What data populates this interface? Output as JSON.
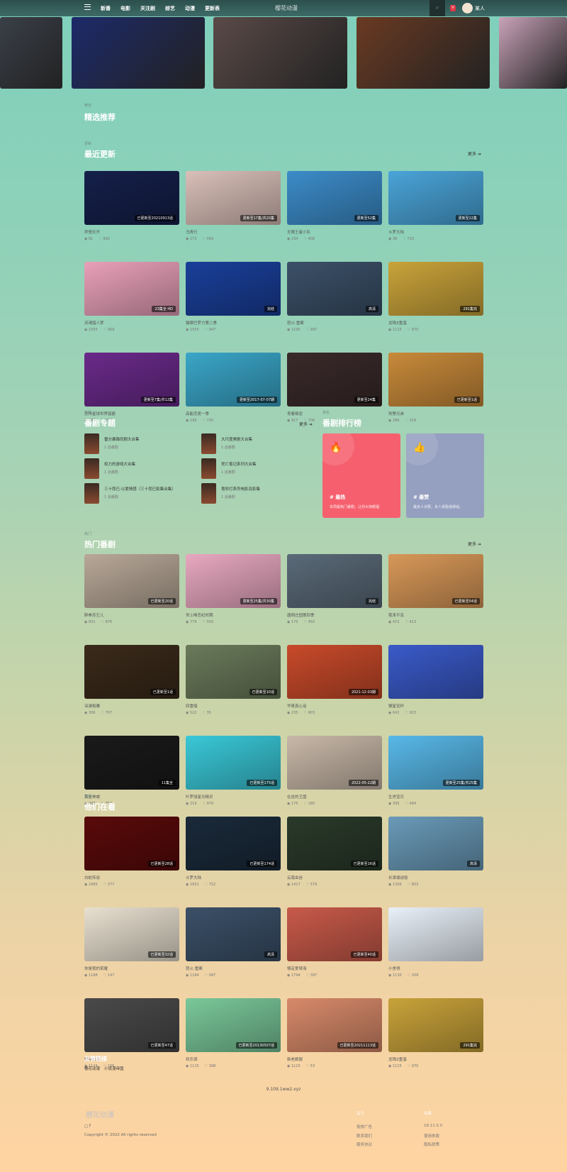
{
  "header": {
    "nav": [
      "新番",
      "电影",
      "关注剧",
      "综艺",
      "动漫",
      "更新表"
    ],
    "logo": "樱花动漫",
    "search_icon": "search-icon",
    "vip": "V",
    "username": "某人"
  },
  "banners": [
    {
      "color": "#3a3f48"
    },
    {
      "color": "#1d2a6a"
    },
    {
      "color": "#5a4a48"
    },
    {
      "color": "#6a3a22"
    },
    {
      "color": "#c9a2b8"
    }
  ],
  "featured": {
    "label": "精选",
    "title": "精选推荐"
  },
  "recent": {
    "label": "更新",
    "title": "最近更新",
    "more": "更多 ➔",
    "items": [
      {
        "name": "异想天开",
        "badge": "已更新至20210913话",
        "views": "81",
        "likes": "992",
        "color": "#15204a"
      },
      {
        "name": "乌青行",
        "badge": "更新至17集/共20集",
        "views": "272",
        "likes": "569",
        "color": "#d9bfb8"
      },
      {
        "name": "无限王者小队",
        "badge": "更新至52集",
        "views": "234",
        "likes": "408",
        "color": "#3c8cc9"
      },
      {
        "name": "斗罗大陆",
        "badge": "更新至22集",
        "views": "38",
        "likes": "729",
        "color": "#4aa4d8"
      },
      {
        "name": "灵魂猎人梦",
        "badge": "23集全 HD",
        "views": "1055",
        "likes": "909",
        "color": "#e8a0b8"
      },
      {
        "name": "猫眼巴罗力第二季",
        "badge": "完结",
        "views": "1055",
        "likes": "947",
        "color": "#1a3f9a"
      },
      {
        "name": "怒火·重案",
        "badge": "高清",
        "views": "1195",
        "likes": "997",
        "color": "#3b5068"
      },
      {
        "name": "龙珠Z重温",
        "badge": "291集完",
        "views": "1115",
        "likes": "970",
        "color": "#c9a33a"
      },
      {
        "name": "恐怖星球世界猎爵",
        "badge": "更新至7集/共12集",
        "views": "988",
        "likes": "833",
        "color": "#6a2a8a"
      },
      {
        "name": "高能恋爱一季",
        "badge": "更新至2017-07-07期",
        "views": "196",
        "likes": "730",
        "color": "#3aa6c8"
      },
      {
        "name": "青春叛逆",
        "badge": "更新至24集",
        "views": "917",
        "likes": "706",
        "color": "#3a2a2a"
      },
      {
        "name": "刑警兄弟",
        "badge": "已更新至1话",
        "views": "286",
        "likes": "529",
        "color": "#c88a3a"
      }
    ]
  },
  "topics": {
    "label": "专题",
    "title": "番剧专题",
    "more": "更多 ➔",
    "items": [
      {
        "name": "雷分暴躁同剧大合集",
        "count": "1 话番剧"
      },
      {
        "name": "大尺度美剧大合集",
        "count": "1 话番剧"
      },
      {
        "name": "权力的游戏大合集",
        "count": "1 话番剧"
      },
      {
        "name": "死亡笔记系列大合集",
        "count": "1 话番剧"
      },
      {
        "name": "三十而已·以爱情感（三十而已影集合集）",
        "count": "1 话番剧"
      },
      {
        "name": "鬼吹灯系列电影及影集",
        "count": "1 话番剧"
      }
    ]
  },
  "ranking": {
    "label": "排名",
    "title": "番剧排行榜",
    "items": [
      {
        "title": "# 最热",
        "desc": "本周最热门番剧，让你大饱眼福",
        "icon": "fire-icon",
        "color": "#f6606e"
      },
      {
        "title": "# 最赞",
        "desc": "最多人点赞，多人观看值得追。",
        "icon": "thumbs-up-icon",
        "color": "#959fc0"
      }
    ]
  },
  "hot": {
    "label": "热门",
    "title": "热门番剧",
    "more": "更多 ➔",
    "items": [
      {
        "name": "醉拳苏乞儿",
        "badge": "已更新至20话",
        "views": "831",
        "likes": "876",
        "color": "#b8a898"
      },
      {
        "name": "世上唯恋纪时期",
        "badge": "更新至25集/共30集",
        "views": "779",
        "likes": "550",
        "color": "#e8a8c0"
      },
      {
        "name": "唐顿庄园第四季",
        "badge": "完结",
        "views": "175",
        "likes": "450",
        "color": "#5a6a78"
      },
      {
        "name": "我来不及",
        "badge": "已更新至54话",
        "views": "472",
        "likes": "413",
        "color": "#d89858"
      },
      {
        "name": "深渊极雕",
        "badge": "已更新至1话",
        "views": "306",
        "likes": "707",
        "color": "#3a2a1a"
      },
      {
        "name": "四重唱",
        "badge": "已更新至10话",
        "views": "522",
        "likes": "35",
        "color": "#6a7a5a"
      },
      {
        "name": "华哥真心话",
        "badge": "2021-12-03期",
        "views": "235",
        "likes": "903",
        "color": "#c84a2a"
      },
      {
        "name": "猴星宝杯",
        "badge": "",
        "views": "642",
        "likes": "923",
        "color": "#3a5ac8"
      },
      {
        "name": "黄金神威",
        "badge": "11集全",
        "views": "808",
        "likes": "752",
        "color": "#1a1a1a"
      },
      {
        "name": "叶罗丽星光精灵",
        "badge": "已更新至175话",
        "views": "219",
        "likes": "979",
        "color": "#3ac8d8"
      },
      {
        "name": "在这的王国",
        "badge": "2022-05-22期",
        "views": "175",
        "likes": "180",
        "color": "#c8b8a8"
      },
      {
        "name": "生肖宝贝",
        "badge": "更新至25集/共25集",
        "views": "395",
        "likes": "494",
        "color": "#58b8e8"
      }
    ]
  },
  "watching": {
    "label": "热播",
    "title": "他们在看",
    "items": [
      {
        "name": "白蛇传说",
        "badge": "已更新至28话",
        "views": "2485",
        "likes": "377",
        "color": "#5a0a0a"
      },
      {
        "name": "斗罗大陆",
        "badge": "已更新至174话",
        "views": "1651",
        "likes": "752",
        "color": "#1a2a3a"
      },
      {
        "name": "云南虫谷",
        "badge": "已更新至16话",
        "views": "1417",
        "likes": "579",
        "color": "#2a3a2a"
      },
      {
        "name": "长津湖战役",
        "badge": "高清",
        "views": "1306",
        "likes": "803",
        "color": "#6a9ab8"
      },
      {
        "name": "你是我的荣耀",
        "badge": "已更新至32话",
        "views": "1188",
        "likes": "147",
        "color": "#e8e0d0"
      },
      {
        "name": "怒火·重案",
        "badge": "高清",
        "views": "1184",
        "likes": "997",
        "color": "#3b5068"
      },
      {
        "name": "情定爱琴海",
        "badge": "已更新至40话",
        "views": "1794",
        "likes": "397",
        "color": "#c85a4a"
      },
      {
        "name": "小舍得",
        "badge": "",
        "views": "1130",
        "likes": "209",
        "color": "#e8f0f8"
      },
      {
        "name": "警中故事",
        "badge": "已更新至47话",
        "views": "1124",
        "likes": "166",
        "color": "#4a4a4a"
      },
      {
        "name": "欢乐颂",
        "badge": "已更新至20130507话",
        "views": "1115",
        "likes": "398",
        "color": "#7ac89a"
      },
      {
        "name": "新老娘舅",
        "badge": "已更新至20211113话",
        "views": "1115",
        "likes": "53",
        "color": "#d88a6a"
      },
      {
        "name": "龙珠Z重温",
        "badge": "291集完",
        "views": "1115",
        "likes": "970",
        "color": "#c9a33a"
      }
    ]
  },
  "links": {
    "title": "友情链接",
    "items": [
      "樱花动漫",
      "小说漫帝国"
    ]
  },
  "domain": "9.109.1ww2.xyz",
  "footer": {
    "logo": "樱花动漫",
    "copyright": "Copyright © 2022 All rights reserved",
    "cols": [
      {
        "title": "关于",
        "items": [
          "投放广告",
          "联系我们",
          "服务协议"
        ]
      },
      {
        "title": "合集",
        "items": [
          "18.11.5.0",
          "使用条款",
          "隐私政策"
        ]
      }
    ]
  }
}
